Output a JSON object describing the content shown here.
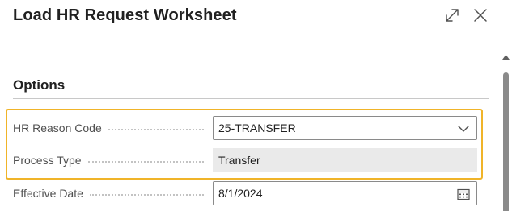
{
  "dialog": {
    "title": "Load HR Request Worksheet"
  },
  "options": {
    "section_title": "Options",
    "fields": [
      {
        "label": "HR Reason Code",
        "value": "25-TRANSFER",
        "control": "dropdown"
      },
      {
        "label": "Process Type",
        "value": "Transfer",
        "control": "readonly"
      },
      {
        "label": "Effective Date",
        "value": "8/1/2024",
        "control": "date"
      }
    ]
  },
  "colors": {
    "highlight_border": "#f0b429",
    "readonly_bg": "#eaeaea",
    "input_border": "#8a8a8a"
  },
  "icons": [
    "expand-icon",
    "close-icon",
    "chevron-down-icon",
    "calendar-icon",
    "scroll-up-arrow-icon"
  ]
}
